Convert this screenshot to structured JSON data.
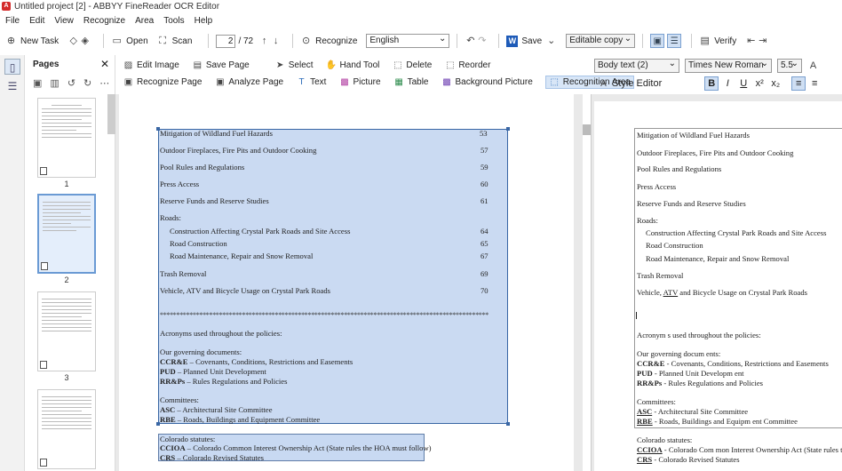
{
  "window": {
    "title": "Untitled project [2] - ABBYY FineReader OCR Editor"
  },
  "menu": [
    "File",
    "Edit",
    "View",
    "Recognize",
    "Area",
    "Tools",
    "Help"
  ],
  "toolbar": {
    "new_task": "New Task",
    "open": "Open",
    "scan": "Scan",
    "page_current": "2",
    "page_total": "/ 72",
    "recognize": "Recognize",
    "language": "English",
    "save": "Save",
    "save_mode": "Editable copy",
    "verify": "Verify"
  },
  "pages_panel": {
    "title": "Pages",
    "thumbnails": [
      {
        "num": "1"
      },
      {
        "num": "2"
      },
      {
        "num": "3"
      },
      {
        "num": ""
      }
    ]
  },
  "ribbon": {
    "row1": {
      "edit_image": "Edit Image",
      "save_page": "Save Page",
      "select": "Select",
      "hand_tool": "Hand Tool",
      "delete": "Delete",
      "reorder": "Reorder"
    },
    "row2": {
      "recognize_page": "Recognize Page",
      "analyze_page": "Analyze Page",
      "text": "Text",
      "picture": "Picture",
      "table": "Table",
      "background_picture": "Background Picture",
      "recognition_area": "Recognition Area"
    }
  },
  "right_ribbon": {
    "style": "Body text (2)",
    "font": "Times New Roman",
    "size": "5.5",
    "style_editor": "Style Editor"
  },
  "document": {
    "toc": [
      {
        "text": "Mitigation of Wildland Fuel Hazards",
        "page": "53"
      },
      {
        "text": "Outdoor Fireplaces, Fire Pits and Outdoor Cooking",
        "page": "57"
      },
      {
        "text": "Pool Rules and Regulations",
        "page": "59"
      },
      {
        "text": "Press Access",
        "page": "60"
      },
      {
        "text": "Reserve Funds and Reserve Studies",
        "page": "61"
      },
      {
        "text": "Roads:",
        "page": ""
      },
      {
        "text": "Construction Affecting Crystal Park Roads and Site Access",
        "page": "64"
      },
      {
        "text": "Road Construction",
        "page": "65"
      },
      {
        "text": "Road Maintenance, Repair and Snow Removal",
        "page": "67"
      },
      {
        "text": "Trash Removal",
        "page": "69"
      },
      {
        "text": "Vehicle, ATV and Bicycle Usage on Crystal Park Roads",
        "page": "70"
      }
    ],
    "stars": "****************************************************************************************************",
    "acronyms_heading": "Acronyms used throughout the policies:",
    "governing_heading": "Our governing documents:",
    "governing": [
      {
        "abbr": "CCR&E",
        "desc": " – Covenants, Conditions, Restrictions and Easements"
      },
      {
        "abbr": "PUD",
        "desc": " – Planned Unit Development"
      },
      {
        "abbr": "RR&Ps",
        "desc": " – Rules Regulations and Policies"
      }
    ],
    "committees_heading": "Committees:",
    "committees": [
      {
        "abbr": "ASC",
        "desc": " – Architectural Site Committee"
      },
      {
        "abbr": "RBE",
        "desc": " – Roads, Buildings and Equipment Committee"
      }
    ],
    "statutes_heading": "Colorado statutes:",
    "statutes": [
      {
        "abbr": "CCIOA",
        "desc": " – Colorado Common Interest Ownership Act (State rules the HOA must follow)"
      },
      {
        "abbr": "CRS",
        "desc": " – Colorado Revised Statutes"
      }
    ]
  },
  "recognized": {
    "lines": [
      "Mitigation of Wildland Fuel Hazards",
      "Outdoor Fireplaces, Fire Pits and Outdoor Cooking",
      "Pool Rules and Regulations",
      "Press Access",
      "Reserve Funds and Reserve Studies",
      "Roads:",
      "Construction Affecting Crystal Park Roads and Site Access",
      "Road Construction",
      "Road Maintenance, Repair and Snow Removal",
      "Trash Removal"
    ],
    "vehicle_pre": "Vehicle, ",
    "vehicle_atv": "ATV",
    "vehicle_post": " and Bicycle Usage on Crystal Park Roads",
    "acronyms_heading": "Acronym s used throughout the policies:",
    "governing_heading": "Our governing docum ents:",
    "governing": [
      {
        "abbr": "CCR&E",
        "desc": " - Covenants, Conditions, Restrictions and Easements"
      },
      {
        "abbr": "PUD",
        "desc": " - Planned Unit Developm ent"
      },
      {
        "abbr": "RR&Ps",
        "desc": " - Rules Regulations and Policies"
      }
    ],
    "committees_heading": "Committees:",
    "committees": [
      {
        "abbr": "ASC",
        "desc": " - Architectural Site Committee"
      },
      {
        "abbr": "RBE",
        "desc": " - Roads, Buildings and Equipm ent Committee"
      }
    ],
    "statutes_heading": "Colorado statutes:",
    "statutes": [
      {
        "abbr": "CCIOA",
        "desc": " - Colorado Com mon Interest Ownership Act (State rules the"
      },
      {
        "abbr": "CRS",
        "desc": " - Colorado Revised Statutes"
      }
    ]
  }
}
